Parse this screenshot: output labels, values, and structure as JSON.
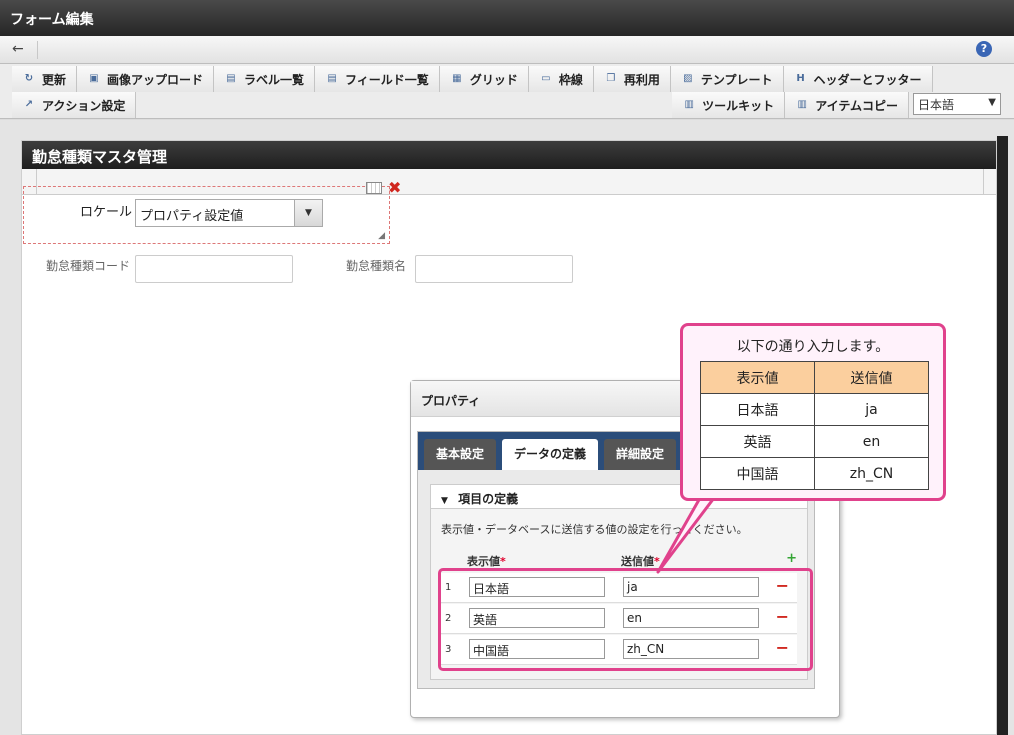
{
  "window": {
    "title": "フォーム編集"
  },
  "nav": {
    "back_icon": "←",
    "help_icon": "?"
  },
  "toolbar": {
    "row1": [
      {
        "label": "更新",
        "icon": "↻"
      },
      {
        "label": "画像アップロード",
        "icon": "▣"
      },
      {
        "label": "ラベル一覧",
        "icon": "▤"
      },
      {
        "label": "フィールド一覧",
        "icon": "▤"
      },
      {
        "label": "グリッド",
        "icon": "▦"
      },
      {
        "label": "枠線",
        "icon": "▭"
      },
      {
        "label": "再利用",
        "icon": "❐"
      },
      {
        "label": "テンプレート",
        "icon": "▨"
      },
      {
        "label": "ヘッダーとフッター",
        "icon": "H"
      }
    ],
    "row2": [
      {
        "label": "アクション設定",
        "icon": "↗"
      }
    ],
    "right": [
      {
        "label": "ツールキット",
        "icon": "▥"
      },
      {
        "label": "アイテムコピー",
        "icon": "▥"
      }
    ],
    "language": "日本語",
    "language_arrow": "▼"
  },
  "form": {
    "title": "勤怠種類マスタ管理",
    "fields": {
      "code_label": "勤怠種類コード",
      "name_label": "勤怠種類名"
    },
    "locale": {
      "label": "ロケール",
      "value": "プロパティ設定値",
      "arrow": "▼",
      "delete_icon": "✖",
      "resize_icon": "◢"
    }
  },
  "dialog": {
    "title": "プロパティ",
    "tabs": [
      "基本設定",
      "データの定義",
      "詳細設定"
    ],
    "section_title": "項目の定義",
    "section_toggle": "▼",
    "description": "表示値・データベースに送信する値の設定を行ってください。",
    "columns": {
      "display": "表示値",
      "send": "送信値",
      "required_mark": "*"
    },
    "add_icon": "+",
    "remove_icon": "−",
    "rows": [
      {
        "num": "1",
        "display": "日本語",
        "send": "ja"
      },
      {
        "num": "2",
        "display": "英語",
        "send": "en"
      },
      {
        "num": "3",
        "display": "中国語",
        "send": "zh_CN"
      }
    ]
  },
  "callout": {
    "title": "以下の通り入力します。",
    "headers": [
      "表示値",
      "送信値"
    ],
    "rows": [
      [
        "日本語",
        "ja"
      ],
      [
        "英語",
        "en"
      ],
      [
        "中国語",
        "zh_CN"
      ]
    ]
  },
  "colors": {
    "highlight": "#e0428c",
    "callout_bg": "#fff2fb",
    "callout_header": "#fbcf9e",
    "tabbar": "#2b4d7a"
  }
}
